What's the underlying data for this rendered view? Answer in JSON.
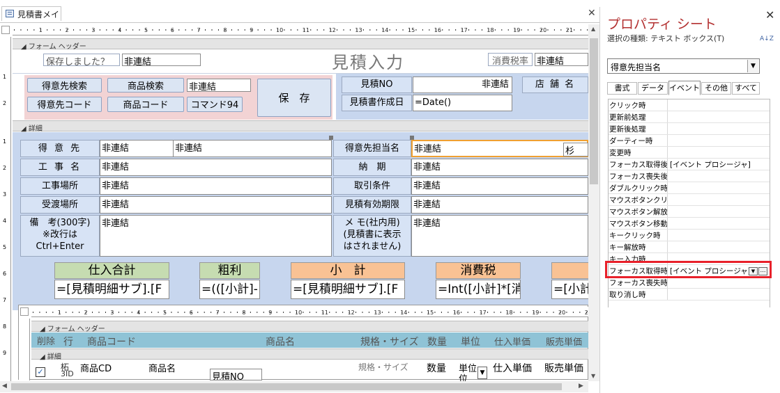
{
  "tab": {
    "title": "見積書メイン",
    "close": "✕"
  },
  "form_header_label": "フォーム ヘッダー",
  "detail_label": "詳細",
  "ruler_numbers": [
    "1",
    "2",
    "3",
    "4",
    "5",
    "6",
    "7",
    "8",
    "9",
    "10",
    "11",
    "12",
    "13",
    "14",
    "15",
    "16",
    "17",
    "18",
    "19",
    "20",
    "21"
  ],
  "vruler_top": [
    "1",
    "2"
  ],
  "vruler_mid": [
    "1",
    "2",
    "3",
    "4",
    "5",
    "6",
    "7",
    "8",
    "9"
  ],
  "header": {
    "saved_label": "保存しました？",
    "unbound_1": "非連結",
    "form_title": "見積入力",
    "tax_rate_label": "消費税率",
    "tax_rate_value": "非連結",
    "btn_customer_search": "得意先検索",
    "btn_product_search": "商品検索",
    "unbound_2": "非連結",
    "btn_save": "保　存",
    "btn_customer_code": "得意先コード",
    "btn_product_code": "商品コード",
    "btn_command94": "コマンド94",
    "quote_no_label": "見積NO",
    "quote_no_value": "非連結",
    "store_label": "店 舗 名",
    "created_date_label": "見積書作成日",
    "created_date_value": "=Date()"
  },
  "detail": {
    "customer_label": "得 意 先",
    "customer_v1": "非連結",
    "customer_v2": "非連結",
    "rep_label": "得意先担当名",
    "rep_value": "非連結",
    "rep_extra": "杉",
    "project_label": "工 事 名",
    "project_value": "非連結",
    "delivery_label": "納　期",
    "delivery_value": "非連結",
    "site_label": "工事場所",
    "site_value": "非連結",
    "terms_label": "取引条件",
    "terms_value": "非連結",
    "handover_label": "受渡場所",
    "handover_value": "非連結",
    "validity_label": "見積有効期限",
    "validity_value": "非連結",
    "remarks_label_1": "備　考(300字)",
    "remarks_label_2": "※改行は",
    "remarks_label_3": "Ctrl+Enter",
    "remarks_value": "非連結",
    "memo_label_1": "メ モ(社内用)",
    "memo_label_2": "(見積書に表示",
    "memo_label_3": "はされません)",
    "memo_value": "非連結"
  },
  "totals": [
    {
      "label": "仕入合計",
      "expr": "=[見積明細サブ].[F"
    },
    {
      "label": "粗利",
      "expr": "=(([小計]-"
    },
    {
      "label": "小　計",
      "expr": "=[見積明細サブ].[F"
    },
    {
      "label": "消費税",
      "expr": "=Int([小計]*[消"
    },
    {
      "label": "",
      "expr": "=[小計"
    }
  ],
  "subform": {
    "header_label": "フォーム ヘッダー",
    "detail_label": "詳細",
    "columns": [
      "削除",
      "行",
      "商品コード",
      "商品名",
      "規格・サイズ",
      "数量",
      "単位",
      "仕入単価",
      "販売単価"
    ],
    "fields": {
      "code": "商品CD",
      "name": "商品名",
      "quote_no": "見積NO",
      "spec": "規格・サイズ",
      "qty": "数量",
      "unit": "単位",
      "unit_ext": "位",
      "cost": "仕入単価",
      "price": "販売単価",
      "line": "柘",
      "line2": "3ID"
    }
  },
  "property_sheet": {
    "title": "プロパティ シート",
    "selection_type": "選択の種類: テキスト ボックス(T)",
    "object": "得意先担当名",
    "sort_icon": "A↓Z",
    "tabs": [
      "書式",
      "データ",
      "イベント",
      "その他",
      "すべて"
    ],
    "active_tab": "イベント",
    "rows": [
      {
        "key": "クリック時",
        "value": ""
      },
      {
        "key": "更新前処理",
        "value": ""
      },
      {
        "key": "更新後処理",
        "value": ""
      },
      {
        "key": "ダーティー時",
        "value": ""
      },
      {
        "key": "変更時",
        "value": ""
      },
      {
        "key": "フォーカス取得後",
        "value": "[イベント プロシージャ]"
      },
      {
        "key": "フォーカス喪失後",
        "value": ""
      },
      {
        "key": "ダブルクリック時",
        "value": ""
      },
      {
        "key": "マウスボタンクリック",
        "value": ""
      },
      {
        "key": "マウスボタン解放",
        "value": ""
      },
      {
        "key": "マウスボタン移動",
        "value": ""
      },
      {
        "key": "キークリック時",
        "value": ""
      },
      {
        "key": "キー解放時",
        "value": ""
      },
      {
        "key": "キー入力時",
        "value": ""
      },
      {
        "key": "フォーカス取得時",
        "value": "[イベント プロシージャ]"
      },
      {
        "key": "フォーカス喪失時",
        "value": ""
      },
      {
        "key": "取り消し時",
        "value": ""
      }
    ],
    "highlight_color": "#e8202a"
  },
  "colors": {
    "label_blue": "#d7e3f5",
    "green": "#c6dcb1",
    "orange": "#f9c294",
    "accent_red": "#b33030",
    "selected_orange": "#f0a030"
  }
}
